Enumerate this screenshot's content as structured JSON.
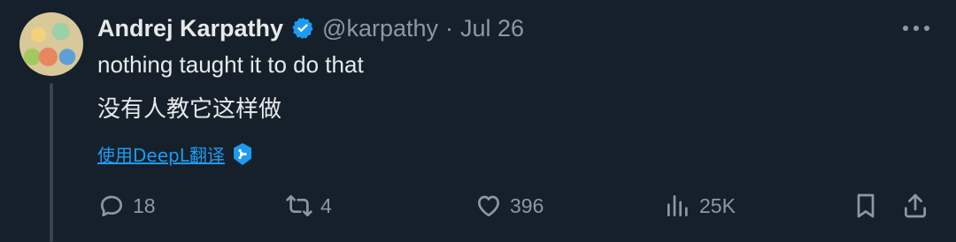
{
  "tweet": {
    "author_name": "Andrej Karpathy",
    "handle": "@karpathy",
    "separator": "·",
    "date": "Jul 26",
    "text_en": "nothing taught it to do that",
    "text_zh": "没有人教它这样做",
    "translate_link": "使用DeepL翻译"
  },
  "actions": {
    "replies": "18",
    "retweets": "4",
    "likes": "396",
    "views": "25K"
  },
  "icons": {
    "verified": "verified-badge-icon",
    "more": "more-dots-icon",
    "deepl": "deepl-icon",
    "reply": "reply-icon",
    "retweet": "retweet-icon",
    "like": "heart-icon",
    "views": "views-icon",
    "bookmark": "bookmark-icon",
    "share": "share-icon"
  },
  "colors": {
    "background": "#15202b",
    "accent": "#1d9bf0",
    "muted": "#8b98a5",
    "text": "#e7e9ea"
  }
}
